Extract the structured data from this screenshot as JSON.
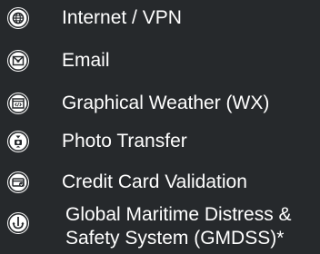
{
  "services": {
    "items": [
      {
        "icon": "globe-icon",
        "label": "Internet / VPN"
      },
      {
        "icon": "email-icon",
        "label": "Email"
      },
      {
        "icon": "weather-window-icon",
        "label": "Graphical Weather (WX)"
      },
      {
        "icon": "photo-transfer-icon",
        "label": "Photo Transfer"
      },
      {
        "icon": "credit-card-icon",
        "label": "Credit Card Validation"
      },
      {
        "icon": "distress-anchor-icon",
        "label_line1": "Global Maritime Distress &",
        "label_line2": "Safety System (GMDSS)*"
      }
    ]
  },
  "colors": {
    "background": "#26292c",
    "text": "#ffffff",
    "icon_fill": "#ffffff",
    "icon_glyph": "#26292c"
  }
}
